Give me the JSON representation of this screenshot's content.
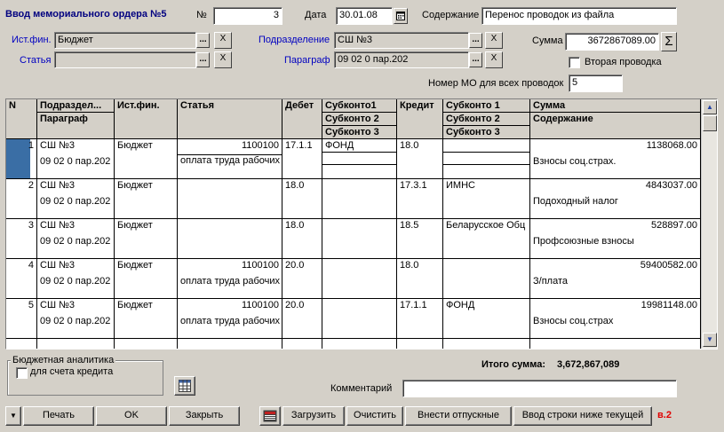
{
  "form": {
    "title": "Ввод мемориального ордера №5",
    "number_label": "№",
    "number_value": "3",
    "date_label": "Дата",
    "date_value": "30.01.08",
    "content_label": "Содержание",
    "content_value": "Перенос проводок из файла",
    "istfin_label": "Ист.фин.",
    "istfin_value": "Бюджет",
    "statya_label": "Статья",
    "statya_value": "",
    "podrazd_label": "Подразделение",
    "podrazd_value": "СШ №3",
    "paragraf_label": "Параграф",
    "paragraf_value": "09 02 0 пар.202",
    "summa_label": "Сумма",
    "summa_value": "3672867089.00",
    "sigma_symbol": "Σ",
    "second_entry_label": "Вторая проводка",
    "mo_number_label": "Номер МО для всех проводок",
    "mo_number_value": "5",
    "ellipsis": "...",
    "clear_symbol": "X"
  },
  "grid": {
    "headers": {
      "n": "N",
      "podrazd": "Подраздел...",
      "paragraf": "Параграф",
      "istfin": "Ист.фин.",
      "statya": "Статья",
      "debet": "Дебет",
      "subk1_d": "Субконто1",
      "subk2_d": "Субконто 2",
      "subk3_d": "Субконто 3",
      "kredit": "Кредит",
      "subk1_k": "Субконто 1",
      "subk2_k": "Субконто 2",
      "subk3_k": "Субконто 3",
      "summa": "Сумма",
      "soderzhanie": "Содержание"
    },
    "rows": [
      {
        "n": "1",
        "podrazd": "СШ №3",
        "paragraf": "09 02 0 пар.202",
        "istfin": "Бюджет",
        "statya_code": "1100100",
        "statya_name": "оплата труда рабочих",
        "debet": "17.1.1",
        "subk_d": "ФОНД",
        "kredit": "18.0",
        "subk_k": "",
        "summa": "1138068.00",
        "soderzhanie": "Взносы соц.страх."
      },
      {
        "n": "2",
        "podrazd": "СШ №3",
        "paragraf": "09 02 0 пар.202",
        "istfin": "Бюджет",
        "statya_code": "",
        "statya_name": "",
        "debet": "18.0",
        "subk_d": "",
        "kredit": "17.3.1",
        "subk_k": "ИМНС",
        "summa": "4843037.00",
        "soderzhanie": "Подоходный налог"
      },
      {
        "n": "3",
        "podrazd": "СШ №3",
        "paragraf": "09 02 0 пар.202",
        "istfin": "Бюджет",
        "statya_code": "",
        "statya_name": "",
        "debet": "18.0",
        "subk_d": "",
        "kredit": "18.5",
        "subk_k": "Беларусское Обц",
        "summa": "528897.00",
        "soderzhanie": "Профсоюзные взносы"
      },
      {
        "n": "4",
        "podrazd": "СШ №3",
        "paragraf": "09 02 0 пар.202",
        "istfin": "Бюджет",
        "statya_code": "1100100",
        "statya_name": "оплата труда рабочих",
        "debet": "20.0",
        "subk_d": "",
        "kredit": "18.0",
        "subk_k": "",
        "summa": "59400582.00",
        "soderzhanie": "З/плата"
      },
      {
        "n": "5",
        "podrazd": "СШ №3",
        "paragraf": "09 02 0 пар.202",
        "istfin": "Бюджет",
        "statya_code": "1100100",
        "statya_name": "оплата труда рабочих",
        "debet": "20.0",
        "subk_d": "",
        "kredit": "17.1.1",
        "subk_k": "ФОНД",
        "summa": "19981148.00",
        "soderzhanie": "Взносы соц.страх"
      }
    ]
  },
  "bottom": {
    "budget_group_title": "Бюджетная аналитика",
    "credit_account_label": "для счета кредита",
    "total_label": "Итого сумма:",
    "total_value": "3,672,867,089",
    "comment_label": "Комментарий",
    "comment_value": "",
    "version": "в.2"
  },
  "buttons": {
    "print": "Печать",
    "ok": "OK",
    "close": "Закрыть",
    "load": "Загрузить",
    "clear": "Очистить",
    "vacation": "Внести отпускные",
    "insert_row": "Ввод строки ниже текущей"
  }
}
